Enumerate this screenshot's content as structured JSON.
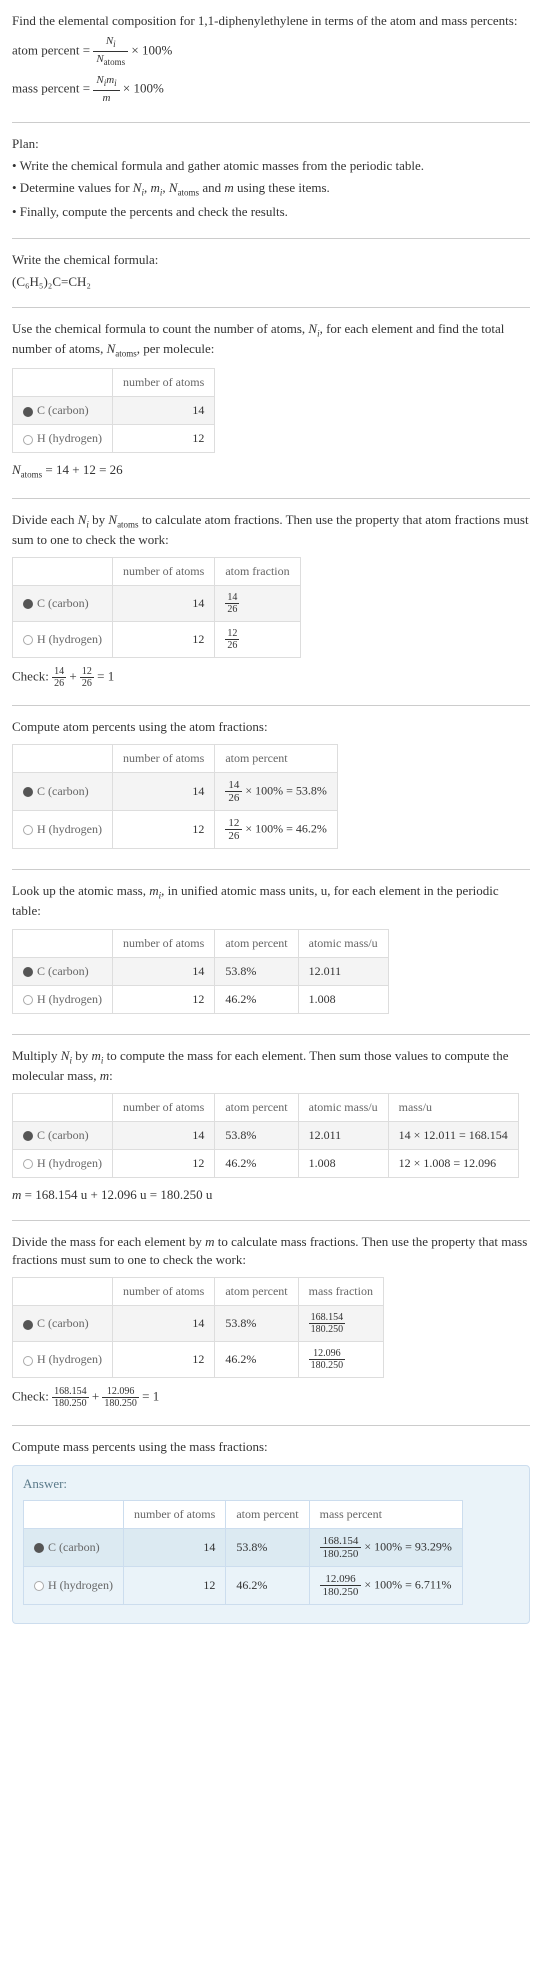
{
  "intro": {
    "line1": "Find the elemental composition for 1,1-diphenylethylene in terms of the atom and mass percents:",
    "atom_percent_label": "atom percent = ",
    "atom_percent_frac_num": "N_i",
    "atom_percent_frac_den": "N_atoms",
    "times100": " × 100%",
    "mass_percent_label": "mass percent = ",
    "mass_percent_frac_num": "N_i m_i",
    "mass_percent_frac_den": "m"
  },
  "plan": {
    "title": "Plan:",
    "bullet1": "• Write the chemical formula and gather atomic masses from the periodic table.",
    "bullet2_pre": "• Determine values for ",
    "bullet2_post": " using these items.",
    "bullet3": "• Finally, compute the percents and check the results."
  },
  "formula_section": {
    "title": "Write the chemical formula:",
    "formula": "(C₆H₅)₂C=CH₂"
  },
  "count_section": {
    "intro_pre": "Use the chemical formula to count the number of atoms, ",
    "intro_mid": ", for each element and find the total number of atoms, ",
    "intro_post": ", per molecule:",
    "headers": {
      "atoms": "number of atoms"
    },
    "rows": [
      {
        "el": "C (carbon)",
        "n": "14",
        "circle": "carbon"
      },
      {
        "el": "H (hydrogen)",
        "n": "12",
        "circle": "hydrogen"
      }
    ],
    "total": " = 14 + 12 = 26"
  },
  "atom_frac_section": {
    "intro_pre": "Divide each ",
    "intro_mid": " by ",
    "intro_post": " to calculate atom fractions. Then use the property that atom fractions must sum to one to check the work:",
    "headers": {
      "atoms": "number of atoms",
      "frac": "atom fraction"
    },
    "rows": [
      {
        "el": "C (carbon)",
        "n": "14",
        "fnum": "14",
        "fden": "26",
        "circle": "carbon"
      },
      {
        "el": "H (hydrogen)",
        "n": "12",
        "fnum": "12",
        "fden": "26",
        "circle": "hydrogen"
      }
    ],
    "check_label": "Check: ",
    "check_eq": " = 1"
  },
  "atom_pct_section": {
    "title": "Compute atom percents using the atom fractions:",
    "headers": {
      "atoms": "number of atoms",
      "pct": "atom percent"
    },
    "rows": [
      {
        "el": "C (carbon)",
        "n": "14",
        "fnum": "14",
        "fden": "26",
        "result": " × 100% = 53.8%",
        "circle": "carbon"
      },
      {
        "el": "H (hydrogen)",
        "n": "12",
        "fnum": "12",
        "fden": "26",
        "result": " × 100% = 46.2%",
        "circle": "hydrogen"
      }
    ]
  },
  "mass_lookup_section": {
    "intro_pre": "Look up the atomic mass, ",
    "intro_post": ", in unified atomic mass units, u, for each element in the periodic table:",
    "headers": {
      "atoms": "number of atoms",
      "pct": "atom percent",
      "mass": "atomic mass/u"
    },
    "rows": [
      {
        "el": "C (carbon)",
        "n": "14",
        "pct": "53.8%",
        "mass": "12.011",
        "circle": "carbon"
      },
      {
        "el": "H (hydrogen)",
        "n": "12",
        "pct": "46.2%",
        "mass": "1.008",
        "circle": "hydrogen"
      }
    ]
  },
  "mass_compute_section": {
    "intro_pre": "Multiply ",
    "intro_mid": " by ",
    "intro_post": " to compute the mass for each element. Then sum those values to compute the molecular mass, ",
    "intro_end": ":",
    "headers": {
      "atoms": "number of atoms",
      "pct": "atom percent",
      "amass": "atomic mass/u",
      "mass": "mass/u"
    },
    "rows": [
      {
        "el": "C (carbon)",
        "n": "14",
        "pct": "53.8%",
        "amass": "12.011",
        "calc": "14 × 12.011 = 168.154",
        "circle": "carbon"
      },
      {
        "el": "H (hydrogen)",
        "n": "12",
        "pct": "46.2%",
        "amass": "1.008",
        "calc": "12 × 1.008 = 12.096",
        "circle": "hydrogen"
      }
    ],
    "total": " = 168.154 u + 12.096 u = 180.250 u"
  },
  "mass_frac_section": {
    "intro_pre": "Divide the mass for each element by ",
    "intro_post": " to calculate mass fractions. Then use the property that mass fractions must sum to one to check the work:",
    "headers": {
      "atoms": "number of atoms",
      "pct": "atom percent",
      "frac": "mass fraction"
    },
    "rows": [
      {
        "el": "C (carbon)",
        "n": "14",
        "pct": "53.8%",
        "fnum": "168.154",
        "fden": "180.250",
        "circle": "carbon"
      },
      {
        "el": "H (hydrogen)",
        "n": "12",
        "pct": "46.2%",
        "fnum": "12.096",
        "fden": "180.250",
        "circle": "hydrogen"
      }
    ],
    "check_label": "Check: ",
    "check_eq": " = 1"
  },
  "mass_pct_section": {
    "title": "Compute mass percents using the mass fractions:",
    "answer_label": "Answer:",
    "headers": {
      "atoms": "number of atoms",
      "pct": "atom percent",
      "mpct": "mass percent"
    },
    "rows": [
      {
        "el": "C (carbon)",
        "n": "14",
        "pct": "53.8%",
        "fnum": "168.154",
        "fden": "180.250",
        "result": " × 100% = 93.29%",
        "circle": "carbon"
      },
      {
        "el": "H (hydrogen)",
        "n": "12",
        "pct": "46.2%",
        "fnum": "12.096",
        "fden": "180.250",
        "result": " × 100% = 6.711%",
        "circle": "hydrogen"
      }
    ]
  }
}
